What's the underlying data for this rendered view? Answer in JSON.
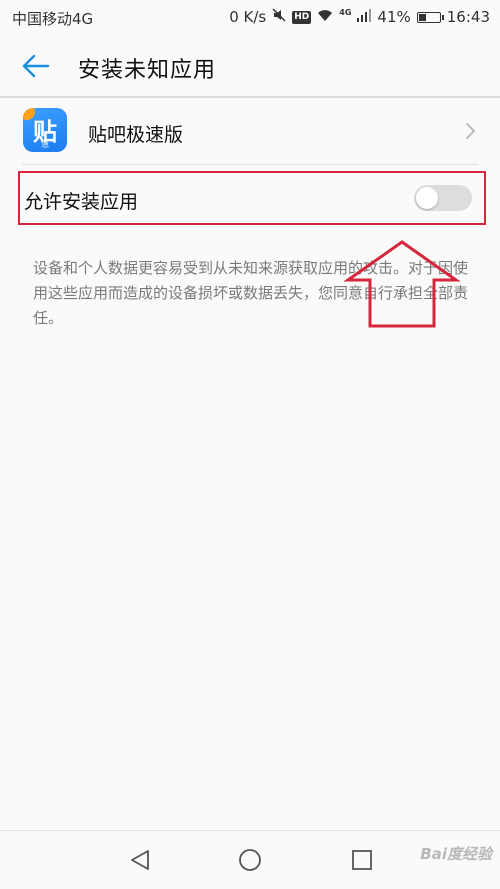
{
  "status_bar": {
    "carrier": "中国移动4G",
    "speed": "0 K/s",
    "hd_label": "HD",
    "network_label": "4G",
    "battery_percent": "41%",
    "battery_level": 0.41,
    "time": "16:43"
  },
  "header": {
    "title": "安装未知应用"
  },
  "app": {
    "name": "贴吧极速版",
    "icon_char": "贴",
    "icon_sub": "急"
  },
  "setting": {
    "label": "允许安装应用",
    "enabled": false
  },
  "description": "设备和个人数据更容易受到从未知来源获取应用的攻击。对于因使用这些应用而造成的设备损坏或数据丢失，您同意自行承担全部责任。",
  "watermark": "Bai度经验",
  "colors": {
    "accent": "#1a8fe0",
    "annotation": "#d6263b",
    "toggle_off": "#dddddd",
    "app_icon": "#2a8df5"
  }
}
